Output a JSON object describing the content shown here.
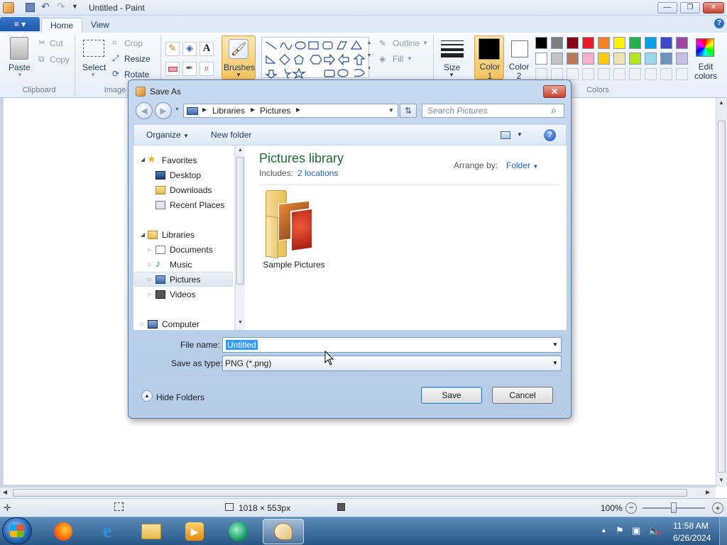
{
  "window": {
    "title": "Untitled - Paint"
  },
  "ribbon": {
    "file_tab": "≡ ▾",
    "tabs": [
      {
        "label": "Home"
      },
      {
        "label": "View"
      }
    ],
    "clipboard": {
      "paste": "Paste",
      "cut": "Cut",
      "copy": "Copy",
      "group": "Clipboard"
    },
    "image": {
      "select": "Select",
      "crop": "Crop",
      "resize": "Resize",
      "rotate": "Rotate",
      "group": "Image"
    },
    "brushes": "Brushes",
    "shapes": {
      "outline": "Outline",
      "fill": "Fill"
    },
    "size": "Size",
    "color1": "Color 1",
    "color2": "Color 2",
    "edit_colors": "Edit colors",
    "colors_group": "Colors",
    "palette_row1": [
      "#000000",
      "#7f7f7f",
      "#880015",
      "#ed1c24",
      "#ff7f27",
      "#fff200",
      "#22b14c",
      "#00a2e8",
      "#3f48cc",
      "#a349a4"
    ],
    "palette_row2": [
      "#ffffff",
      "#c3c3c3",
      "#b97a57",
      "#ffaec9",
      "#ffc90e",
      "#efe4b0",
      "#b5e61d",
      "#99d9ea",
      "#7092be",
      "#c8bfe7"
    ],
    "color1_value": "#000000",
    "color2_value": "#ffffff"
  },
  "dialog": {
    "title": "Save As",
    "breadcrumb": [
      "Libraries",
      "Pictures"
    ],
    "search_placeholder": "Search Pictures",
    "organize": "Organize",
    "new_folder": "New folder",
    "nav": {
      "favorites": "Favorites",
      "favorites_items": [
        "Desktop",
        "Downloads",
        "Recent Places"
      ],
      "libraries": "Libraries",
      "libraries_items": [
        "Documents",
        "Music",
        "Pictures",
        "Videos"
      ],
      "computer": "Computer"
    },
    "library_title": "Pictures library",
    "includes_label": "Includes:",
    "includes_link": "2 locations",
    "arrange_by": "Arrange by:",
    "arrange_value": "Folder",
    "items": [
      {
        "name": "Sample Pictures"
      }
    ],
    "file_name_label": "File name:",
    "file_name_value": "Untitled",
    "save_as_type_label": "Save as type:",
    "save_as_type_value": "PNG (*.png)",
    "hide_folders": "Hide Folders",
    "save": "Save",
    "cancel": "Cancel"
  },
  "status": {
    "dimensions": "1018 × 553px",
    "zoom": "100%"
  },
  "taskbar": {
    "time": "11:58 AM",
    "date": "6/26/2024"
  }
}
